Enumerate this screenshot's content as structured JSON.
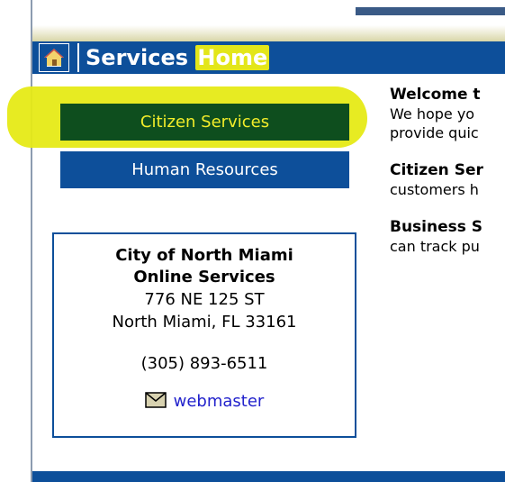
{
  "header": {
    "title_prefix": "Services ",
    "title_highlight": "Home",
    "home_icon": "house-icon"
  },
  "nav": {
    "citizen_services": "Citizen Services",
    "human_resources": "Human Resources"
  },
  "contact": {
    "org_line1": "City of North Miami",
    "org_line2": "Online Services",
    "address1": "776 NE 125 ST",
    "address2": "North Miami, FL 33161",
    "phone": "(305) 893-6511",
    "webmaster_label": "webmaster",
    "mail_icon": "envelope-icon"
  },
  "content": {
    "welcome_heading": "Welcome t",
    "welcome_line1": "We hope yo",
    "welcome_line2": "provide quic",
    "citizen_heading": "Citizen Ser",
    "citizen_line1": "customers h",
    "business_heading": "Business S",
    "business_line1": "can track pu"
  },
  "colors": {
    "brand_blue": "#0d4f9a",
    "highlight_yellow": "#e6ea16",
    "citizen_button_green": "#0e4e1e",
    "link_blue": "#2222cc"
  }
}
